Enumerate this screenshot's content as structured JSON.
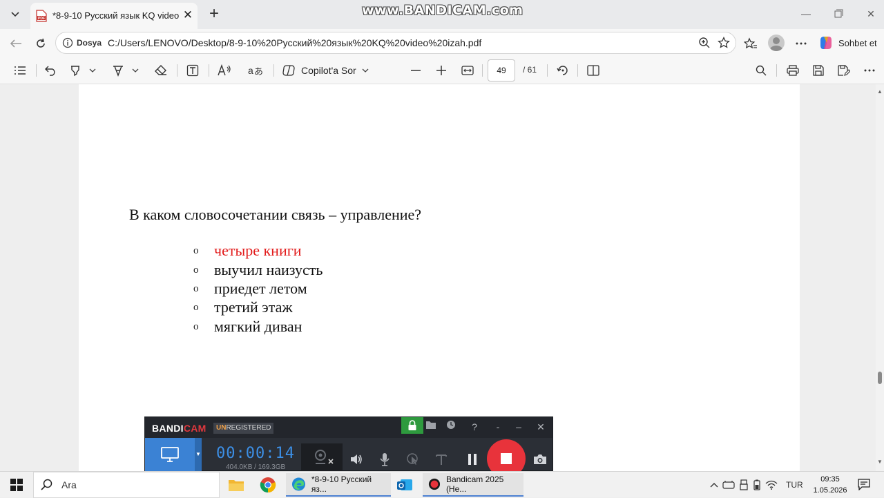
{
  "browser": {
    "tab": {
      "title": "*8-9-10 Русский язык KQ video izah.pdf"
    },
    "watermark": "www.BANDICAM.com",
    "address": {
      "scheme_label": "Dosya",
      "url": "C:/Users/LENOVO/Desktop/8-9-10%20Русский%20язык%20KQ%20video%20izah.pdf"
    },
    "copilot_label": "Sohbet et"
  },
  "pdf_toolbar": {
    "copilot_ask": "Copilot'a Sor",
    "page_current": "49",
    "page_total": "/ 61"
  },
  "document": {
    "question": "В каком словосочетании связь – управление?",
    "bullet": "o",
    "options": [
      {
        "text": "четыре книги",
        "highlighted": true
      },
      {
        "text": "выучил наизусть",
        "highlighted": false
      },
      {
        "text": "приедет летом",
        "highlighted": false
      },
      {
        "text": "третий этаж",
        "highlighted": false
      },
      {
        "text": "мягкий диван",
        "highlighted": false
      }
    ],
    "highlight_color": "#e21b1b"
  },
  "bandicam": {
    "logo_main": "BANDI",
    "logo_accent": "CAM",
    "unregistered_prefix": "UN",
    "unregistered_rest": "REGISTERED",
    "timer": "00:00:14",
    "size": "404.0KB / 169.3GB",
    "accent": "#3b82d4",
    "stop_color": "#e8333b"
  },
  "taskbar": {
    "search_placeholder": "Ara",
    "tasks": [
      {
        "label": "*8-9-10 Русский яз..."
      },
      {
        "label": "Bandicam 2025 (Не..."
      }
    ],
    "tray_lang": "TUR",
    "time": "09:35",
    "date": "1.05.2026"
  }
}
